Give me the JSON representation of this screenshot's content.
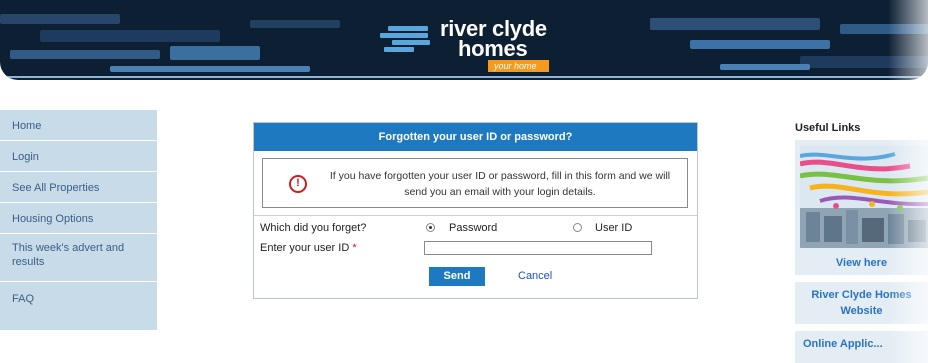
{
  "header": {
    "brand_line1": "river clyde",
    "brand_line2": "homes",
    "tagline": "your home"
  },
  "left_nav": {
    "items": [
      {
        "label": "Home"
      },
      {
        "label": "Login"
      },
      {
        "label": "See All Properties"
      },
      {
        "label": "Housing Options"
      },
      {
        "label": "This week's advert and results"
      },
      {
        "label": "FAQ"
      }
    ]
  },
  "form": {
    "title": "Forgotten your user ID or password?",
    "info_icon": "exclamation-circle-icon",
    "info_text": "If you have forgotten your user ID or password, fill in this form and we will send you an email with your login details.",
    "question_label": "Which did you forget?",
    "options": [
      {
        "label": "Password",
        "checked": true
      },
      {
        "label": "User ID",
        "checked": false
      }
    ],
    "userid_label": "Enter your user ID",
    "required_marker": "*",
    "userid_value": "",
    "send_label": "Send",
    "cancel_label": "Cancel"
  },
  "sidebar": {
    "title": "Useful Links",
    "promo_image": "colourful-city-illustration",
    "view_here_label": "View here",
    "website_label": "River Clyde Homes Website",
    "online_label": "Online Applic..."
  },
  "colors": {
    "header_bg": "#0c1f33",
    "accent_blue": "#1f79c0",
    "nav_bg": "#c8dbe9",
    "tagline_orange": "#f39a1f",
    "required_red": "#d21c1c"
  }
}
